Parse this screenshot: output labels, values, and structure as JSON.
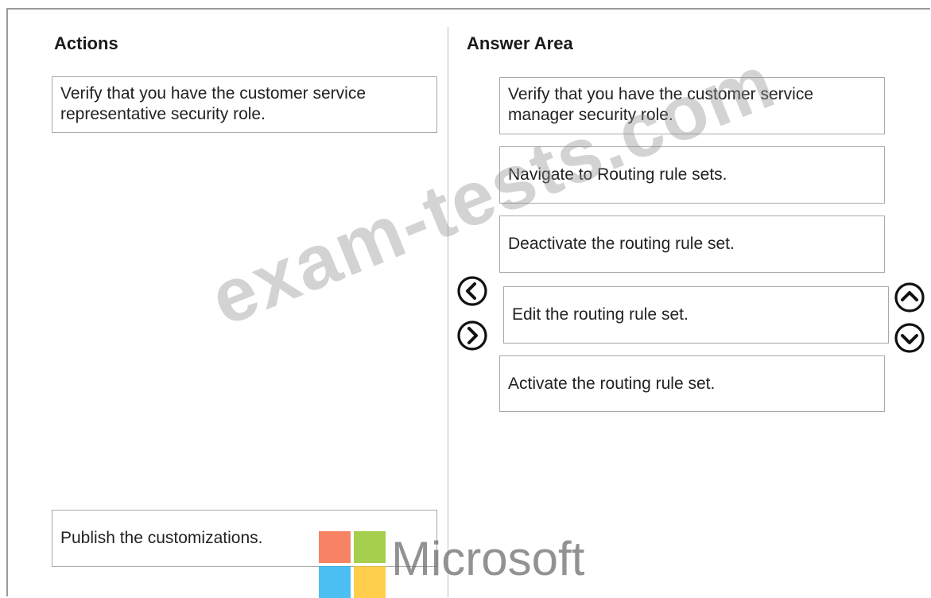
{
  "actions": {
    "heading": "Actions",
    "items": [
      "Verify that you have the customer service representative security role.",
      "Publish the customizations."
    ]
  },
  "answer_area": {
    "heading": "Answer Area",
    "items": [
      "Verify that you have the customer service manager security role.",
      "Navigate to Routing rule sets.",
      "Deactivate the routing rule set.",
      "Edit the routing rule set.",
      "Activate the routing rule set."
    ]
  },
  "controls": {
    "move_left_icon": "chevron-left-circle",
    "move_right_icon": "chevron-right-circle",
    "move_up_icon": "chevron-up-circle",
    "move_down_icon": "chevron-down-circle"
  },
  "watermark": {
    "text": "exam-tests.com",
    "brand": "Microsoft",
    "logo_colors": [
      "#f25022",
      "#7fba00",
      "#00a4ef",
      "#ffb900"
    ]
  }
}
